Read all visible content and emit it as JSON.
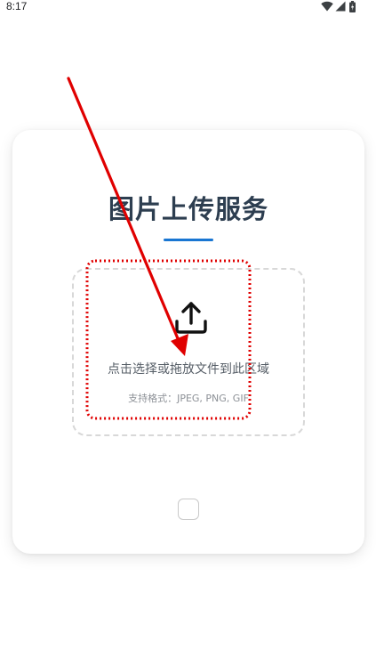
{
  "status_bar": {
    "time": "8:17",
    "icons": [
      "wifi-icon",
      "signal-icon",
      "battery-icon"
    ]
  },
  "card": {
    "title": "图片上传服务",
    "upload_zone": {
      "prompt": "点击选择或拖放文件到此区域",
      "format_hint": "支持格式：JPEG, PNG, GIF",
      "icon": "upload-icon"
    },
    "bottom_control": "checkbox-square"
  },
  "colors": {
    "title": "#2d3e50",
    "accent": "#1976d2",
    "annotation": "#e00000"
  }
}
